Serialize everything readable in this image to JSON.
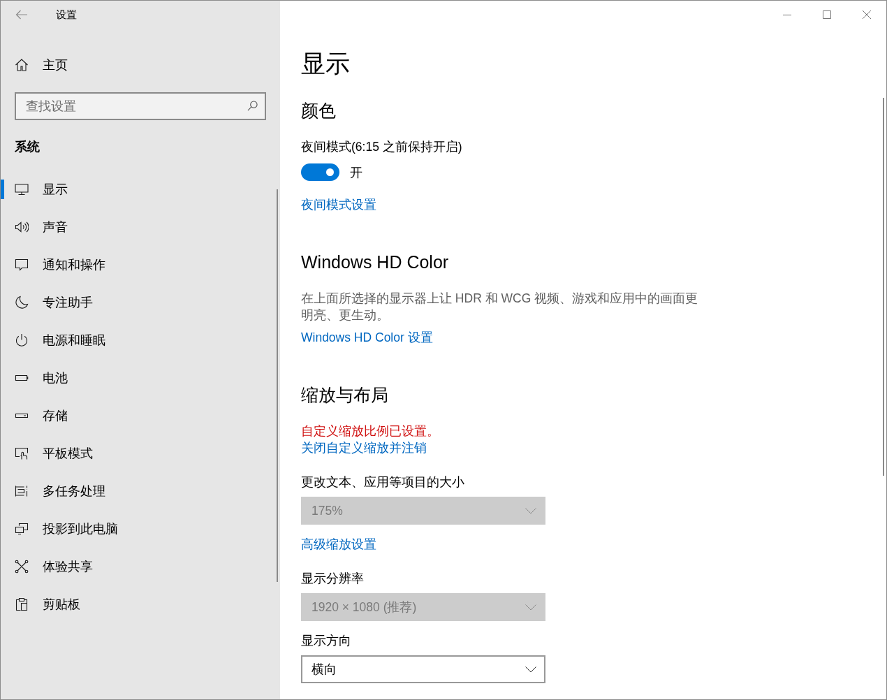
{
  "window": {
    "title": "设置"
  },
  "sidebar": {
    "home": "主页",
    "search": {
      "placeholder": "查找设置"
    },
    "section": "系统",
    "items": [
      {
        "label": "显示",
        "selected": true
      },
      {
        "label": "声音",
        "selected": false
      },
      {
        "label": "通知和操作",
        "selected": false
      },
      {
        "label": "专注助手",
        "selected": false
      },
      {
        "label": "电源和睡眠",
        "selected": false
      },
      {
        "label": "电池",
        "selected": false
      },
      {
        "label": "存储",
        "selected": false
      },
      {
        "label": "平板模式",
        "selected": false
      },
      {
        "label": "多任务处理",
        "selected": false
      },
      {
        "label": "投影到此电脑",
        "selected": false
      },
      {
        "label": "体验共享",
        "selected": false
      },
      {
        "label": "剪贴板",
        "selected": false
      }
    ]
  },
  "page": {
    "title": "显示",
    "sections": [
      {
        "heading": "颜色",
        "items": [
          {
            "kind": "toggle",
            "label": "夜间模式(6:15 之前保持开启)",
            "on": true,
            "state_text": "开"
          },
          {
            "kind": "link",
            "text": "夜间模式设置"
          }
        ]
      },
      {
        "heading": "Windows HD Color",
        "items": [
          {
            "kind": "description",
            "text": "在上面所选择的显示器上让 HDR 和 WCG 视频、游戏和应用中的画面更明亮、更生动。"
          },
          {
            "kind": "link",
            "text": "Windows HD Color 设置"
          }
        ]
      },
      {
        "heading": "缩放与布局",
        "items": [
          {
            "kind": "warning",
            "text": "自定义缩放比例已设置。"
          },
          {
            "kind": "link",
            "text": "关闭自定义缩放并注销"
          },
          {
            "kind": "dropdown",
            "label": "更改文本、应用等项目的大小",
            "value": "175%",
            "disabled": true
          },
          {
            "kind": "link",
            "text": "高级缩放设置"
          },
          {
            "kind": "dropdown",
            "label": "显示分辨率",
            "value": "1920 × 1080 (推荐)",
            "disabled": true
          },
          {
            "kind": "dropdown",
            "label": "显示方向",
            "value": "横向",
            "disabled": false
          }
        ]
      }
    ]
  }
}
